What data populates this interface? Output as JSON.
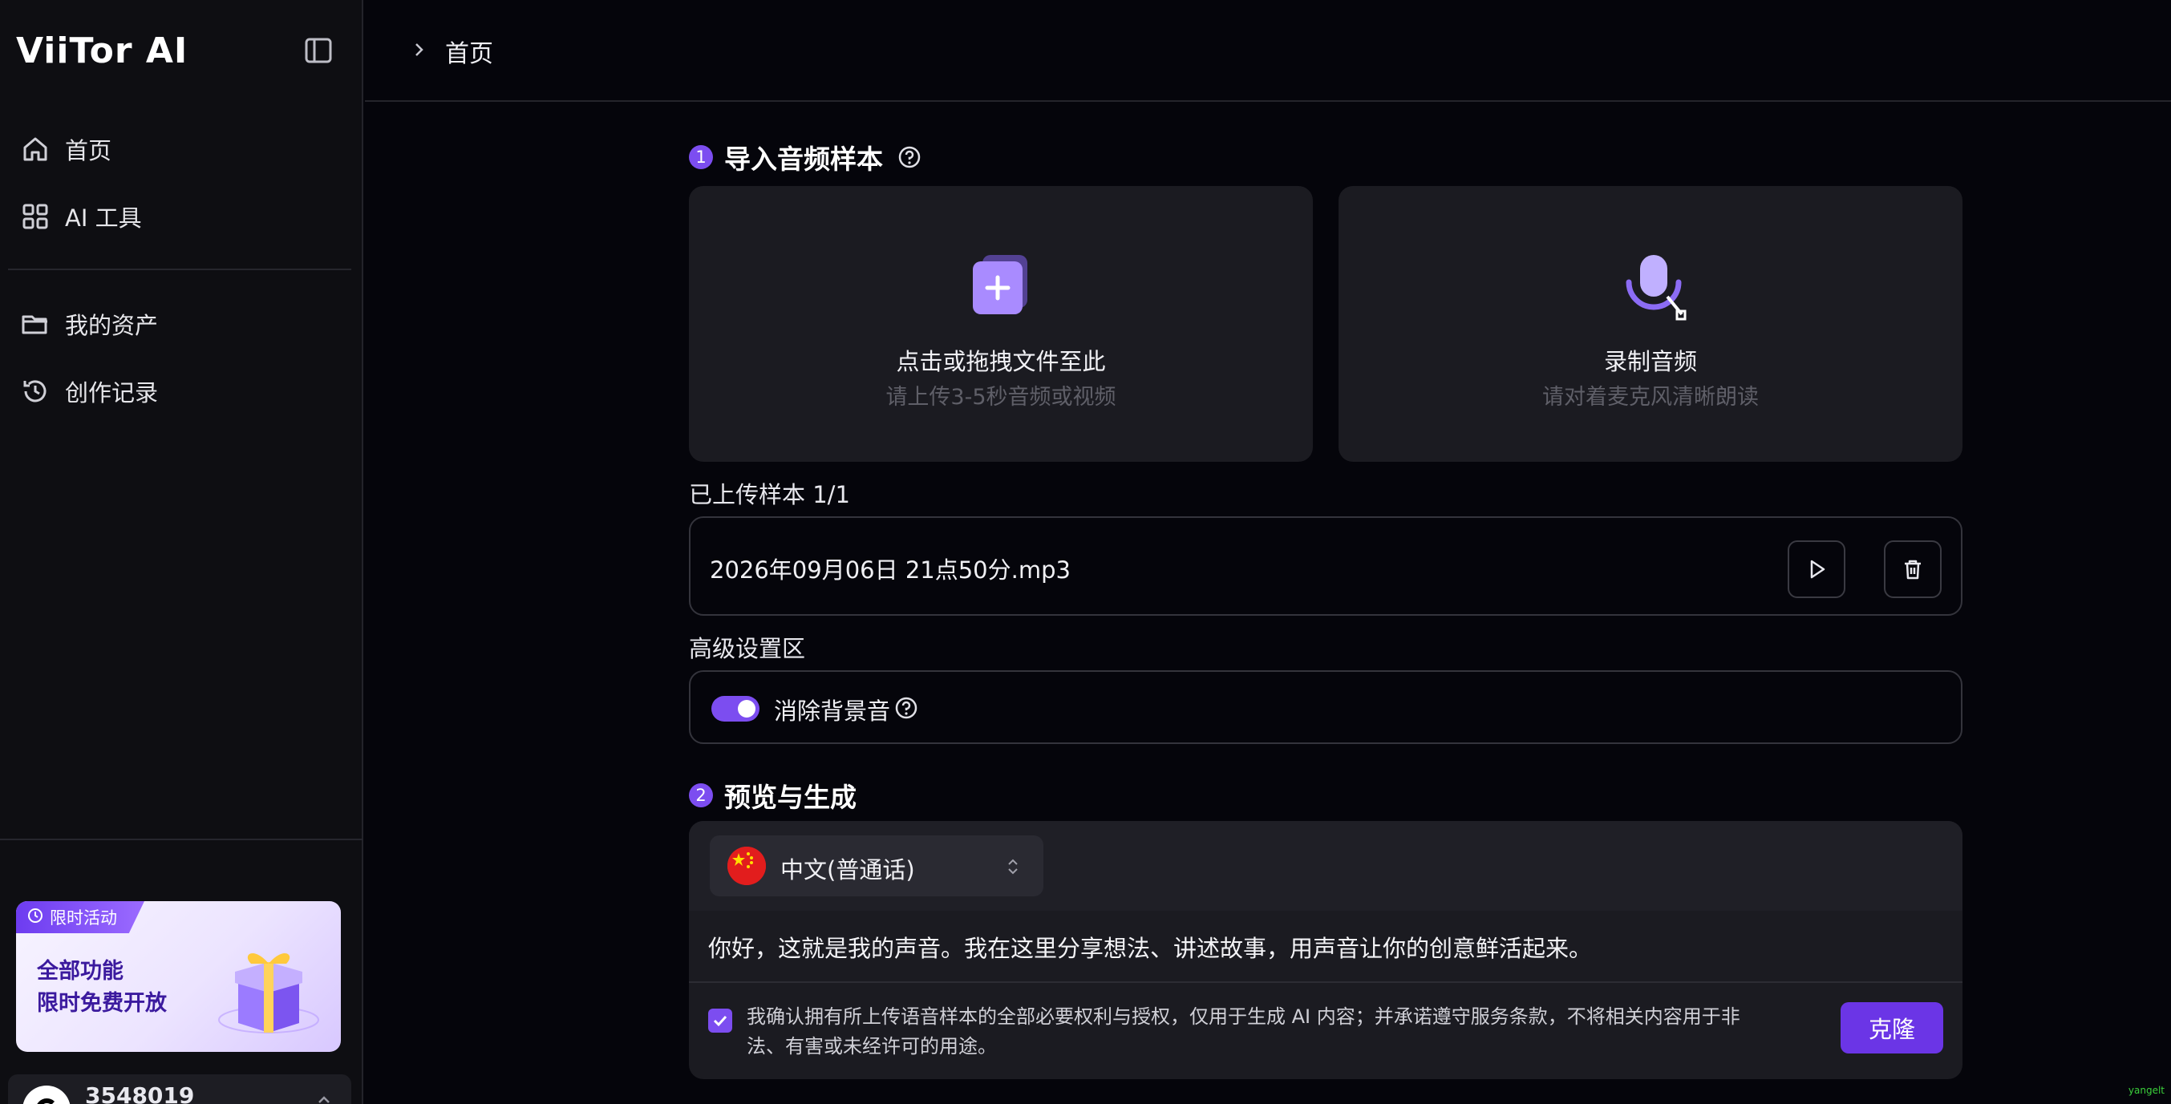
{
  "app": {
    "logo_text": "ViiTor AI"
  },
  "sidebar": {
    "items": [
      {
        "label": "首页",
        "icon": "home-icon"
      },
      {
        "label": "AI 工具",
        "icon": "grid-icon"
      },
      {
        "label": "我的资产",
        "icon": "folder-icon"
      },
      {
        "label": "创作记录",
        "icon": "history-icon"
      }
    ],
    "promo": {
      "tag": "限时活动",
      "line1": "全部功能",
      "line2": "限时免费开放"
    },
    "user": {
      "name": "3548019"
    }
  },
  "header": {
    "breadcrumb": "首页"
  },
  "step1": {
    "number": "1",
    "title": "导入音频样本",
    "upload_card": {
      "title": "点击或拖拽文件至此",
      "subtitle": "请上传3-5秒音频或视频"
    },
    "record_card": {
      "title": "录制音频",
      "subtitle": "请对着麦克风清晰朗读"
    },
    "uploaded_label": "已上传样本 1/1",
    "file_name": "2026年09月06日 21点50分.mp3",
    "advanced_label": "高级设置区",
    "noise_label": "消除背景音",
    "noise_enabled": true
  },
  "step2": {
    "number": "2",
    "title": "预览与生成",
    "language": "中文(普通话)",
    "sample_text": "你好，这就是我的声音。我在这里分享想法、讲述故事，用声音让你的创意鲜活起来。",
    "consent_checked": true,
    "consent_text": "我确认拥有所上传语音样本的全部必要权利与授权，仅用于生成 AI 内容；并承诺遵守服务条款，不将相关内容用于非法、有害或未经许可的用途。",
    "clone_label": "克隆"
  },
  "watermark": "yangelt",
  "colors": {
    "accent": "#7c4df0",
    "button": "#6b35e6",
    "background": "#05050b",
    "sidebar": "#0e0e12",
    "card": "#1b1b21"
  }
}
